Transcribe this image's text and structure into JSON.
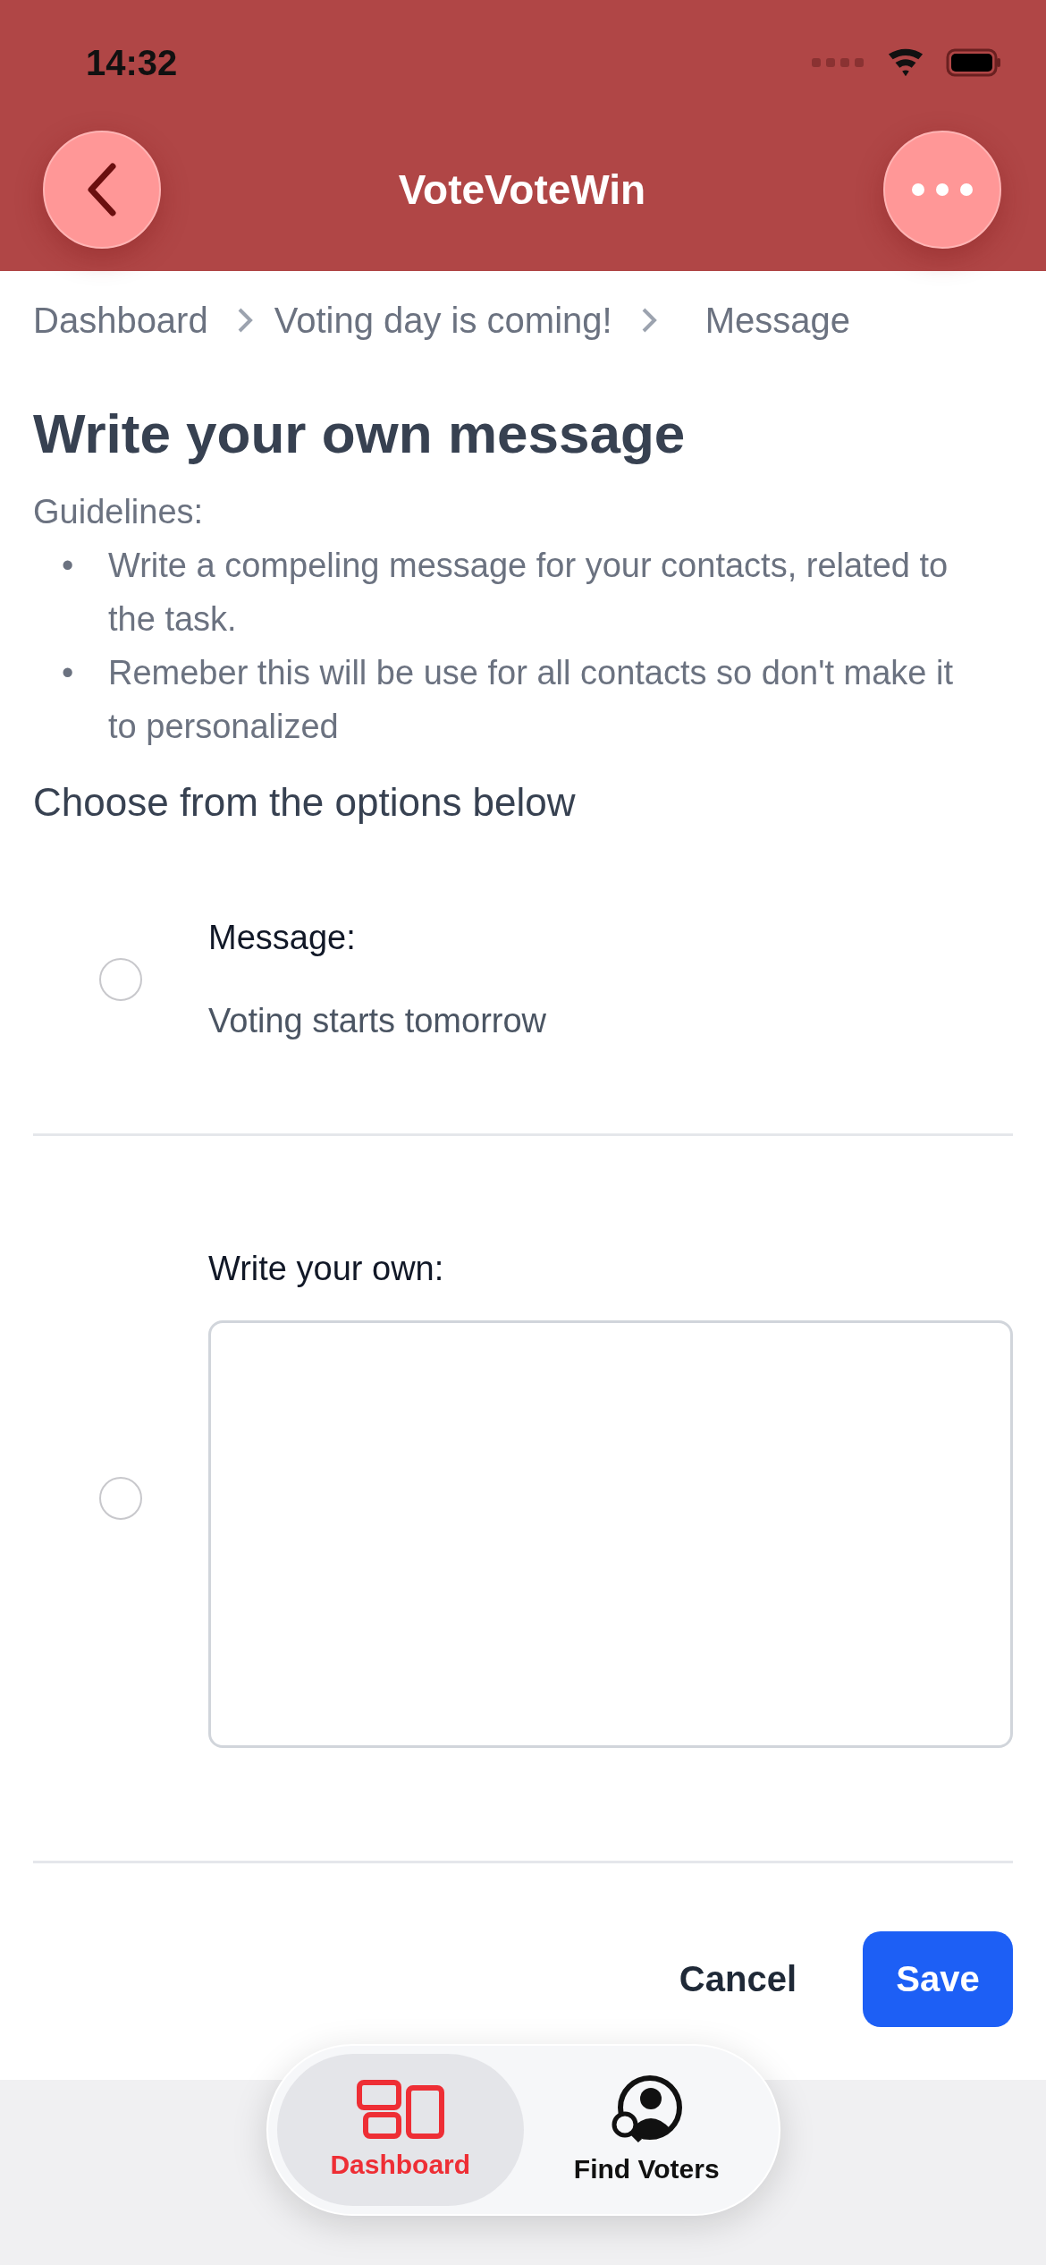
{
  "status_bar": {
    "time": "14:32"
  },
  "header": {
    "title": "VoteVoteWin"
  },
  "breadcrumbs": [
    {
      "label": "Dashboard"
    },
    {
      "label": "Voting day is coming!"
    },
    {
      "label": "Message"
    }
  ],
  "heading": "Write your own message",
  "guidelines": {
    "label": "Guidelines:",
    "items": [
      {
        "bullet": "•",
        "text": "Write a compeling message for your contacts, related to the task."
      },
      {
        "bullet": "•",
        "text": "Remeber this will be use for all contacts so don't make it to personalized"
      }
    ]
  },
  "prompt": "Choose from the options below",
  "options": [
    {
      "kind": "message",
      "label": "Message:",
      "text": "Voting starts tomorrow",
      "selected": false
    },
    {
      "kind": "custom",
      "label": "Write your own:",
      "selected": false
    }
  ],
  "actions": {
    "cancel": "Cancel",
    "save": "Save"
  },
  "tabs": [
    {
      "label": "Dashboard",
      "kind": "dashboard",
      "selected": true
    },
    {
      "label": "Find Voters",
      "kind": "find",
      "selected": false
    }
  ]
}
